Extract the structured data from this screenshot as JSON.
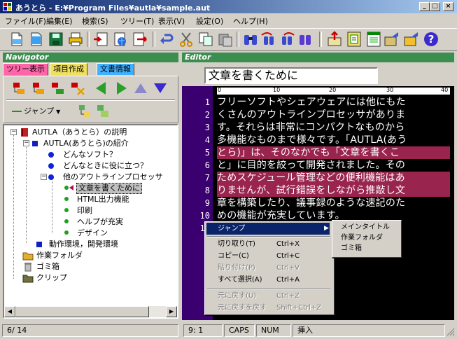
{
  "window": {
    "title": "あうとら - E:¥Program Files¥autla¥sample.aut"
  },
  "menu": [
    "ファイル(F)",
    "編集(E)",
    "検索(S)",
    "ツリー(T)",
    "表示(V)",
    "設定(O)",
    "ヘルプ(H)"
  ],
  "navigator": {
    "header": "Navigotor",
    "tabs": [
      "ツリー表示",
      "項目作成",
      "文書情報"
    ],
    "jump_label": "ジャンプ",
    "tree": [
      {
        "label": "AUTLA（あうとら）の説明"
      },
      {
        "label": "AUTLA(あうとら)の紹介"
      },
      {
        "label": "どんなソフト？"
      },
      {
        "label": "どんなときに役に立つ？"
      },
      {
        "label": "他のアウトラインプロセッサ"
      },
      {
        "label": "文章を書くために"
      },
      {
        "label": "HTML出力機能"
      },
      {
        "label": "印刷"
      },
      {
        "label": "ヘルプが充実"
      },
      {
        "label": "デザイン"
      },
      {
        "label": "動作環境，開発環境"
      },
      {
        "label": "作業フォルダ"
      },
      {
        "label": "ゴミ箱"
      },
      {
        "label": "クリップ"
      }
    ]
  },
  "editor": {
    "header": "Editor",
    "title_value": "文章を書くために",
    "ruler": [
      "0",
      "10",
      "20",
      "30",
      "40"
    ],
    "line_numbers": [
      "1",
      "2",
      "3",
      "4",
      "5",
      "6",
      "7",
      "8",
      "9",
      "10",
      "11"
    ],
    "lines": [
      "フリーソフトやシェアウェアには他にもた",
      "くさんのアウトラインプロセッサがありま",
      "す。それらは非常にコンパクトなものから",
      "多機能なものまで様々です。「AUTLA(あう",
      "とら)」は、そのなかでも「文章を書くこ",
      "と」に目的を絞って開発されました。その",
      "ためスケジュール管理などの便利機能はあ",
      "りませんが、試行錯誤をしながら推敲し文",
      "章を構築したり、議事録のような速記のた",
      "めの機能が充実しています。"
    ]
  },
  "context_menu": {
    "items": [
      {
        "label": "ジャンプ",
        "key": ""
      },
      {
        "label": "切り取り(T)",
        "key": "Ctrl+X"
      },
      {
        "label": "コピー(C)",
        "key": "Ctrl+C"
      },
      {
        "label": "貼り付け(P)",
        "key": "Ctrl+V"
      },
      {
        "label": "すべて選択(A)",
        "key": "Ctrl+A"
      },
      {
        "label": "元に戻す(U)",
        "key": "Ctrl+Z"
      },
      {
        "label": "元に戻すを戻す",
        "key": "Shift+Ctrl+Z"
      }
    ],
    "submenu": [
      "メインタイトル",
      "作業フォルダ",
      "ゴミ箱"
    ]
  },
  "status": {
    "page": "6/ 14",
    "pos": "9: 1",
    "caps": "CAPS",
    "num": "NUM",
    "mode": "挿入"
  },
  "colors": {
    "pane_header": "#3b8e4f",
    "editor_bg": "#000000",
    "gutter": "#3a0070",
    "highlight": "#99244e"
  }
}
